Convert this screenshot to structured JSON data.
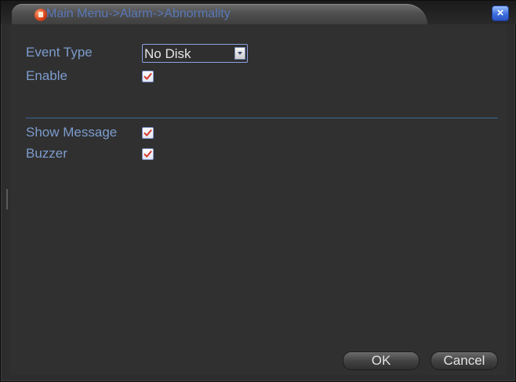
{
  "window": {
    "title": "Main Menu->Alarm->Abnormality",
    "close_label": "×"
  },
  "form": {
    "event_type_label": "Event Type",
    "event_type_value": "No Disk",
    "enable_label": "Enable",
    "enable_checked": true,
    "show_message_label": "Show Message",
    "show_message_checked": true,
    "buzzer_label": "Buzzer",
    "buzzer_checked": true
  },
  "buttons": {
    "ok_label": "OK",
    "cancel_label": "Cancel"
  },
  "colors": {
    "label_text": "#7c9ccd",
    "title_text": "#5878b8",
    "check_mark": "#d63a2a",
    "divider": "#3e6698"
  },
  "icons": {
    "title": "dvr-menu-icon",
    "close": "close-icon",
    "dropdown": "chevron-down-icon",
    "check": "checkmark-icon"
  }
}
